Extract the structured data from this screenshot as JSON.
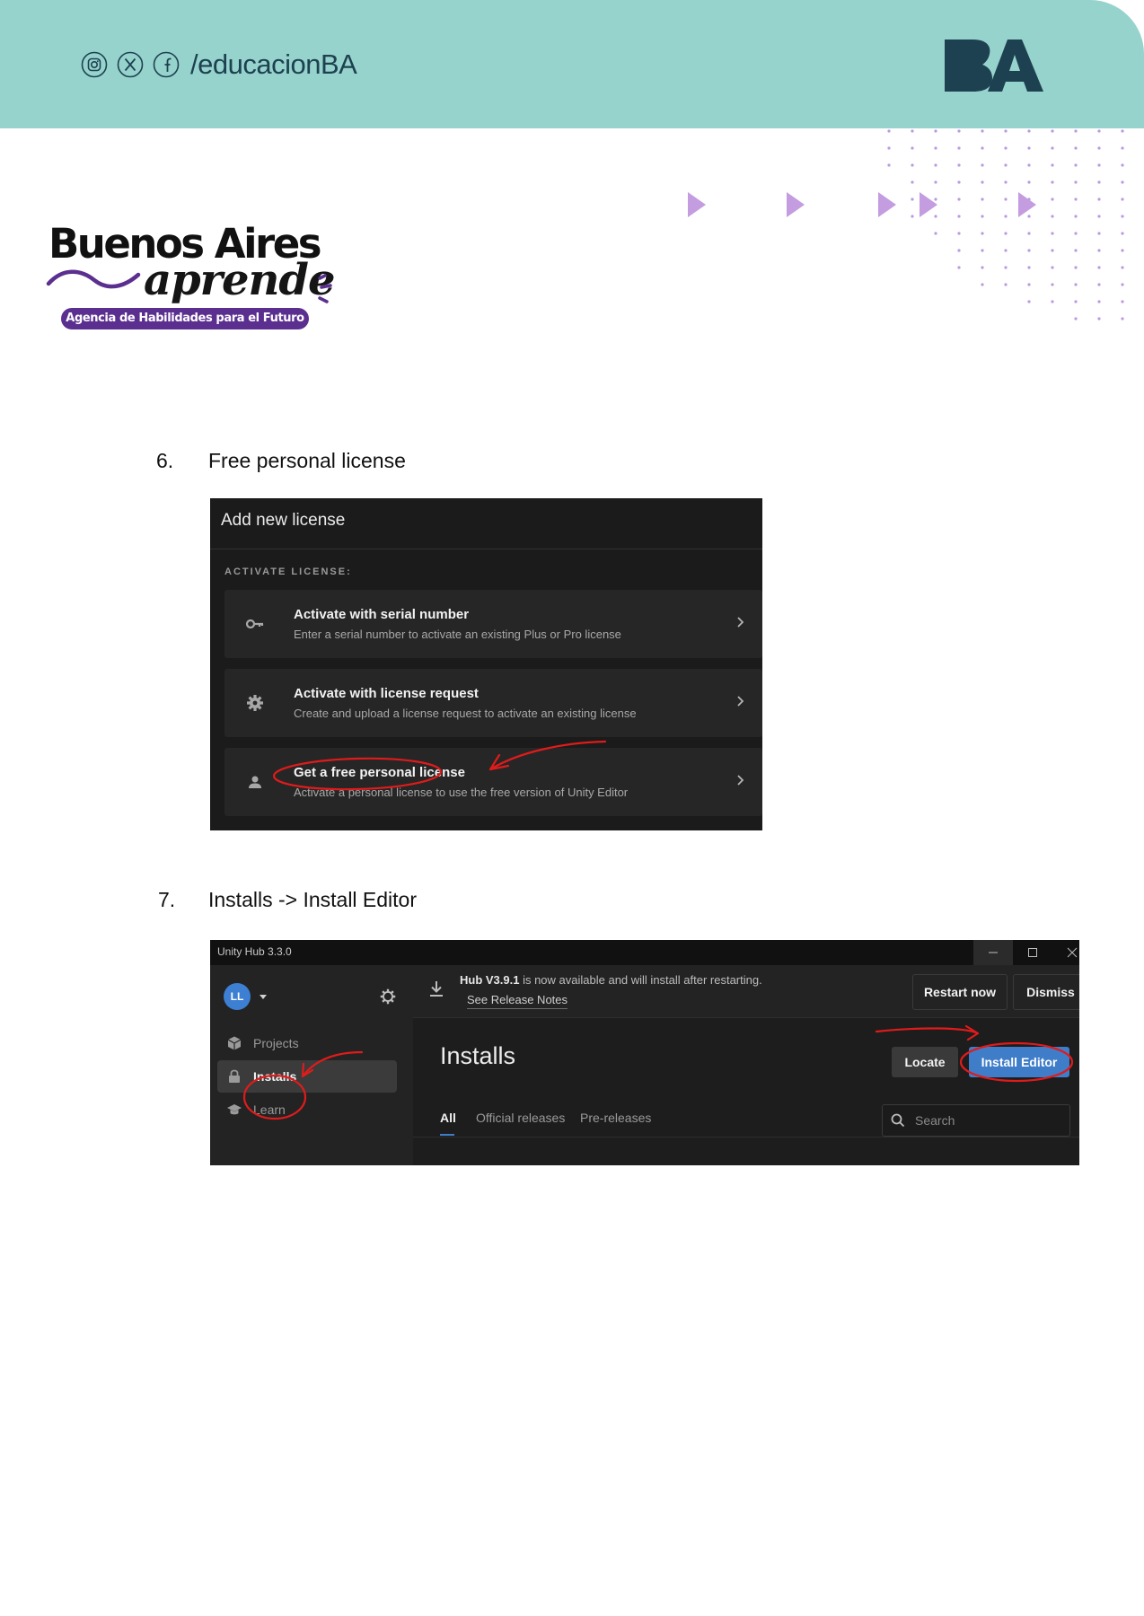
{
  "header": {
    "social_handle": "/educacionBA",
    "social_icons": [
      "instagram-icon",
      "x-icon",
      "facebook-icon"
    ],
    "band_color": "#97d3cd",
    "logo_text": "BA"
  },
  "brand": {
    "title": "Buenos Aires",
    "script": "aprende",
    "tagline": "Agencia de Habilidades para el Futuro",
    "accent_color": "#5b2f8f"
  },
  "steps": [
    {
      "number": "6.",
      "text": "Free personal license"
    },
    {
      "number": "7.",
      "text": "Installs -> Install Editor"
    }
  ],
  "license_dialog": {
    "title": "Add new license",
    "section_label": "ACTIVATE LICENSE:",
    "options": [
      {
        "icon": "key-icon",
        "title": "Activate with serial number",
        "subtitle": "Enter a serial number to activate an existing Plus or Pro license"
      },
      {
        "icon": "gear-icon",
        "title": "Activate with license request",
        "subtitle": "Create and upload a license request to activate an existing license"
      },
      {
        "icon": "person-icon",
        "title": "Get a free personal license",
        "subtitle": "Activate a personal license to use the free version of Unity Editor"
      }
    ]
  },
  "unity_hub": {
    "window_title": "Unity Hub 3.3.0",
    "avatar_initials": "LL",
    "banner": {
      "version": "Hub V3.9.1",
      "message": " is now available and will install after restarting.",
      "link": "See Release Notes",
      "restart_label": "Restart now",
      "dismiss_label": "Dismiss"
    },
    "sidebar": [
      {
        "icon": "cube-icon",
        "label": "Projects",
        "active": false
      },
      {
        "icon": "lock-icon",
        "label": "Installs",
        "active": true
      },
      {
        "icon": "graduation-cap-icon",
        "label": "Learn",
        "active": false
      }
    ],
    "page_title": "Installs",
    "locate_label": "Locate",
    "install_editor_label": "Install Editor",
    "tabs": [
      "All",
      "Official releases",
      "Pre-releases"
    ],
    "active_tab": "All",
    "search_placeholder": "Search",
    "accent_color": "#3f7dc9"
  },
  "annotation_color": "#e01b1b"
}
